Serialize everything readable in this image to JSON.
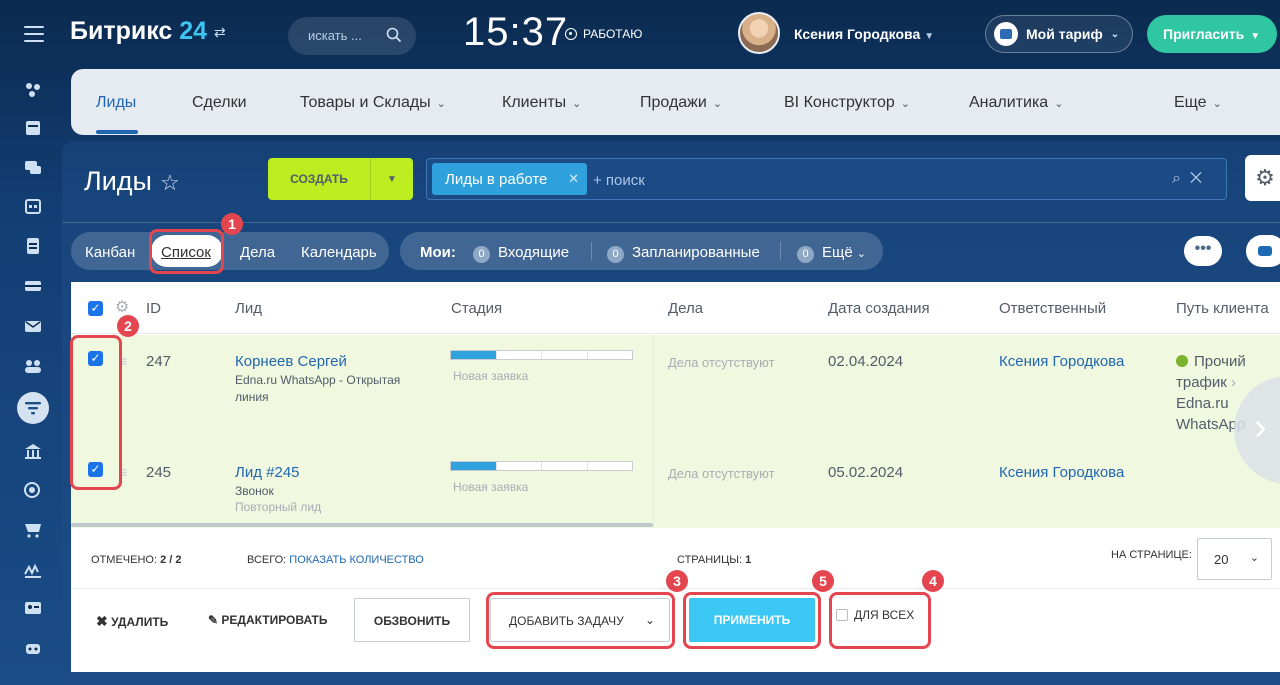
{
  "topbar": {
    "logo_text": "Битрикс",
    "logo_num": "24",
    "search_placeholder": "искать ...",
    "time": "15:37",
    "work_status": "РАБОТАЮ",
    "user_name": "Ксения Городкова",
    "tariff_label": "Мой тариф",
    "invite_label": "Пригласить"
  },
  "menu": {
    "items": [
      {
        "label": "Лиды"
      },
      {
        "label": "Сделки"
      },
      {
        "label": "Товары и Склады"
      },
      {
        "label": "Клиенты"
      },
      {
        "label": "Продажи"
      },
      {
        "label": "BI Конструктор"
      },
      {
        "label": "Аналитика"
      },
      {
        "label": "Еще"
      }
    ]
  },
  "page": {
    "title": "Лиды",
    "create_label": "СОЗДАТЬ",
    "filter_chip": "Лиды в работе",
    "search_placeholder": "+ поиск"
  },
  "views": [
    {
      "label": "Канбан"
    },
    {
      "label": "Список"
    },
    {
      "label": "Дела"
    },
    {
      "label": "Календарь"
    }
  ],
  "counters": {
    "mine_label": "Мои:",
    "incoming": {
      "count": "0",
      "label": "Входящие"
    },
    "planned": {
      "count": "0",
      "label": "Запланированные"
    },
    "more": {
      "count": "0",
      "label": "Ещё"
    }
  },
  "grid": {
    "columns": [
      {
        "label": "ID"
      },
      {
        "label": "Лид"
      },
      {
        "label": "Стадия"
      },
      {
        "label": "Дела"
      },
      {
        "label": "Дата создания"
      },
      {
        "label": "Ответственный"
      },
      {
        "label": "Путь клиента"
      }
    ],
    "rows": [
      {
        "id": "247",
        "name": "Корнеев Сергей",
        "source": "Edna.ru WhatsApp - Открытая линия",
        "extra": "",
        "stage": "Новая заявка",
        "stage_progress": 0.25,
        "activity": "Дела отсутствуют",
        "date": "02.04.2024",
        "responsible": "Ксения Городкова",
        "path_1": "Прочий трафик",
        "path_2": "Edna.ru WhatsApp"
      },
      {
        "id": "245",
        "name": "Лид #245",
        "source": "Звонок",
        "extra": "Повторный лид",
        "stage": "Новая заявка",
        "stage_progress": 0.25,
        "activity": "Дела отсутствуют",
        "date": "05.02.2024",
        "responsible": "Ксения Городкова",
        "path_1": "",
        "path_2": ""
      }
    ]
  },
  "footer": {
    "selected_label": "ОТМЕЧЕНО:",
    "selected_value": "2 / 2",
    "total_label": "ВСЕГО:",
    "total_link": "ПОКАЗАТЬ КОЛИЧЕСТВО",
    "pages_label": "СТРАНИЦЫ:",
    "pages_value": "1",
    "per_page_label": "НА СТРАНИЦЕ:",
    "per_page_value": "20",
    "delete_label": "УДАЛИТЬ",
    "edit_label": "РЕДАКТИРОВАТЬ",
    "dial_label": "ОБЗВОНИТЬ",
    "action_select": "ДОБАВИТЬ ЗАДАЧУ",
    "apply_label": "ПРИМЕНИТЬ",
    "for_all_label": "ДЛЯ ВСЕХ"
  },
  "annotations": [
    "1",
    "2",
    "3",
    "4",
    "5"
  ],
  "colors": {
    "accent": "#2067b0",
    "create": "#bbed21",
    "apply": "#3bc8f5",
    "invite": "#2fc6a1",
    "highlight": "#e4464f",
    "row_selected": "#f1f8e0"
  }
}
